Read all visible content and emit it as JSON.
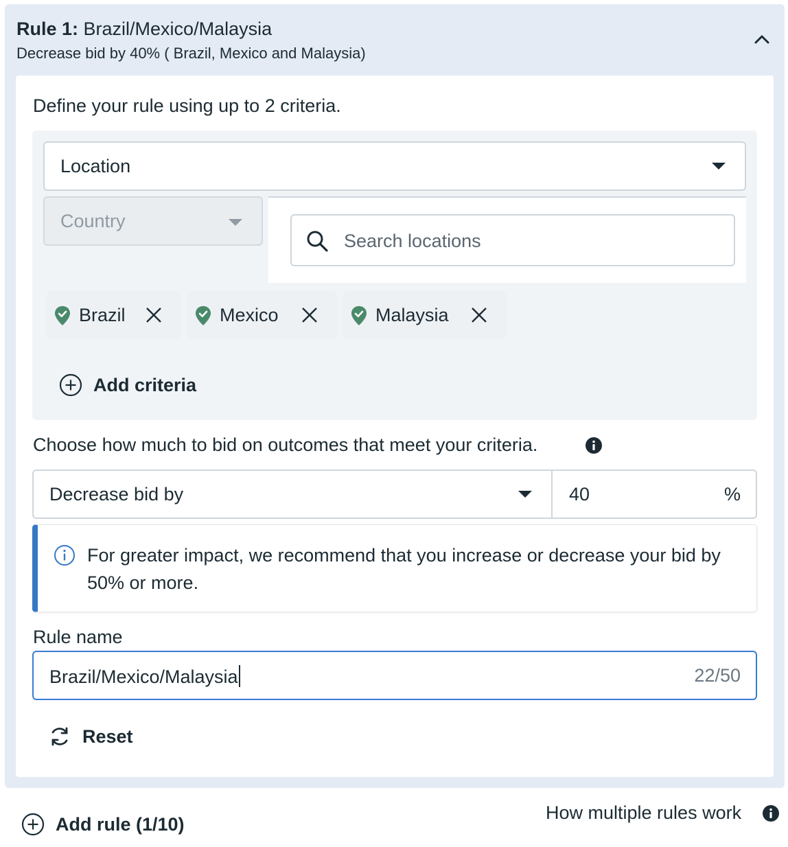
{
  "rule": {
    "title_prefix": "Rule 1",
    "title_separator": ":",
    "title_name": " Brazil/Mexico/Malaysia",
    "subtitle": "Decrease bid by 40% ( Brazil, Mexico and Malaysia)",
    "collapse_icon": "chevron-up-icon"
  },
  "criteria": {
    "intro": "Define your rule using up to 2 criteria.",
    "type_select": "Location",
    "level_select": "Country",
    "search_placeholder": "Search locations",
    "locations": [
      {
        "label": "Brazil"
      },
      {
        "label": "Mexico"
      },
      {
        "label": "Malaysia"
      }
    ],
    "add_label": "Add criteria",
    "pin_color": "#4a8a6a"
  },
  "bid": {
    "prompt": "Choose how much to bid on outcomes that meet your criteria.",
    "adjust_select": "Decrease bid by",
    "value": "40",
    "unit": "%"
  },
  "notice": {
    "message": "For greater impact, we recommend that you increase or decrease your bid by 50% or more.",
    "accent_color": "#3578c5"
  },
  "rule_name": {
    "label": "Rule name",
    "value": "Brazil/Mexico/Malaysia",
    "counter": "22/50"
  },
  "reset_label": "Reset",
  "footer": {
    "add_rule_label": "Add rule (1/10)",
    "help_link": "How multiple rules work"
  }
}
